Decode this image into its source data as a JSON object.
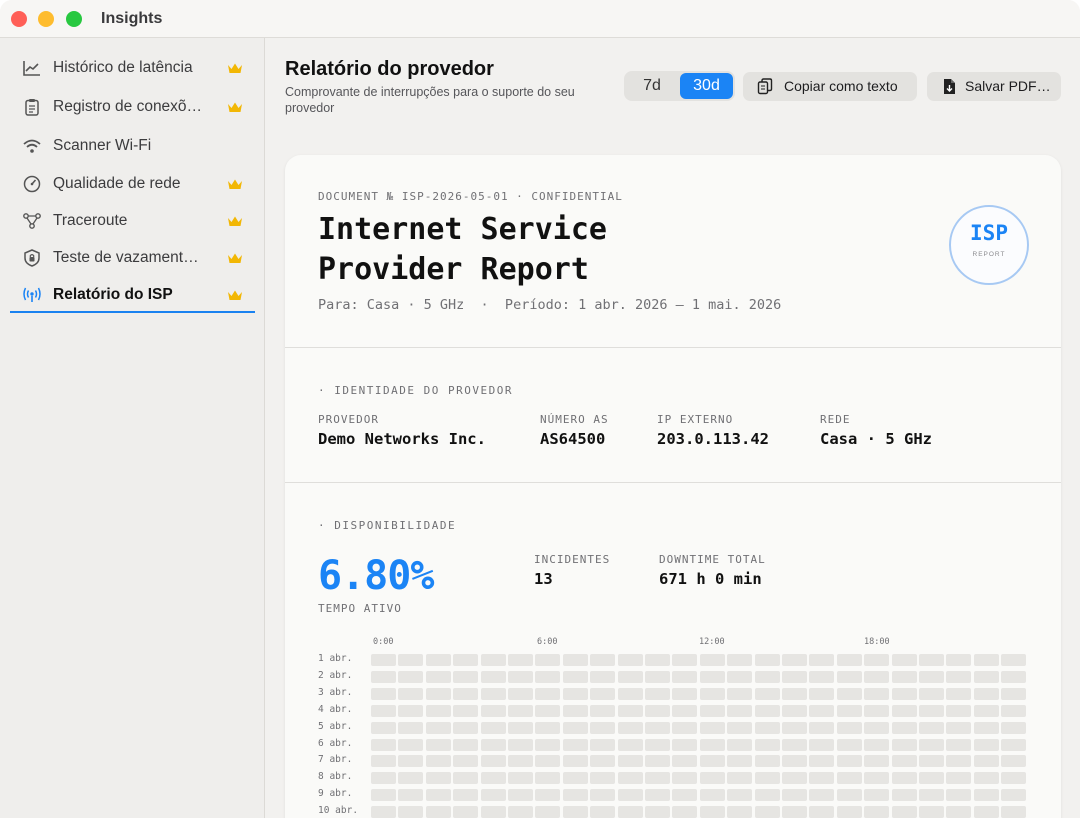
{
  "window": {
    "title": "Insights"
  },
  "sidebar": {
    "items": [
      {
        "label": "Histórico de latência",
        "icon": "chart-line-icon",
        "premium": true
      },
      {
        "label": "Registro de conexõ…",
        "icon": "clipboard-icon",
        "premium": true
      },
      {
        "label": "Scanner Wi-Fi",
        "icon": "wifi-icon",
        "premium": false
      },
      {
        "label": "Qualidade de rede",
        "icon": "gauge-icon",
        "premium": true
      },
      {
        "label": "Traceroute",
        "icon": "network-nodes-icon",
        "premium": true
      },
      {
        "label": "Teste de vazament…",
        "icon": "shield-icon",
        "premium": true
      },
      {
        "label": "Relatório do ISP",
        "icon": "antenna-icon",
        "premium": true,
        "active": true
      }
    ]
  },
  "header": {
    "title": "Relatório do provedor",
    "subtitle": "Comprovante de interrupções para o suporte do seu provedor",
    "ranges": [
      "7d",
      "30d"
    ],
    "selected_range": "30d",
    "copy_label": "Copiar como texto",
    "pdf_label": "Salvar PDF…"
  },
  "report": {
    "meta": "DOCUMENT № ISP-2026-05-01 · CONFIDENTIAL",
    "title": "Internet Service Provider Report",
    "for_line": "Para: Casa · 5 GHz  ·  Período: 1 abr. 2026 — 1 mai. 2026",
    "seal_main": "ISP",
    "seal_sub": "REPORT",
    "identity": {
      "section": "· IDENTIDADE DO PROVEDOR",
      "fields": [
        {
          "label": "PROVEDOR",
          "value": "Demo Networks Inc."
        },
        {
          "label": "NÚMERO AS",
          "value": "AS64500"
        },
        {
          "label": "IP EXTERNO",
          "value": "203.0.113.42"
        },
        {
          "label": "REDE",
          "value": "Casa · 5 GHz"
        }
      ]
    },
    "availability": {
      "section": "· DISPONIBILIDADE",
      "uptime": "6.80%",
      "uptime_label": "TEMPO ATIVO",
      "incidents_label": "INCIDENTES",
      "incidents": "13",
      "downtime_label": "DOWNTIME TOTAL",
      "downtime": "671 h 0 min"
    },
    "heatmap": {
      "hour_labels": [
        "0:00",
        "6:00",
        "12:00",
        "18:00"
      ],
      "days": [
        "1 abr.",
        "2 abr.",
        "3 abr.",
        "4 abr.",
        "5 abr.",
        "6 abr.",
        "7 abr.",
        "8 abr.",
        "9 abr.",
        "10 abr."
      ],
      "cells_per_row": 24,
      "cell_color": "#e6e5e2"
    }
  },
  "colors": {
    "accent": "#1b84f5",
    "crown": "#f2b705"
  }
}
